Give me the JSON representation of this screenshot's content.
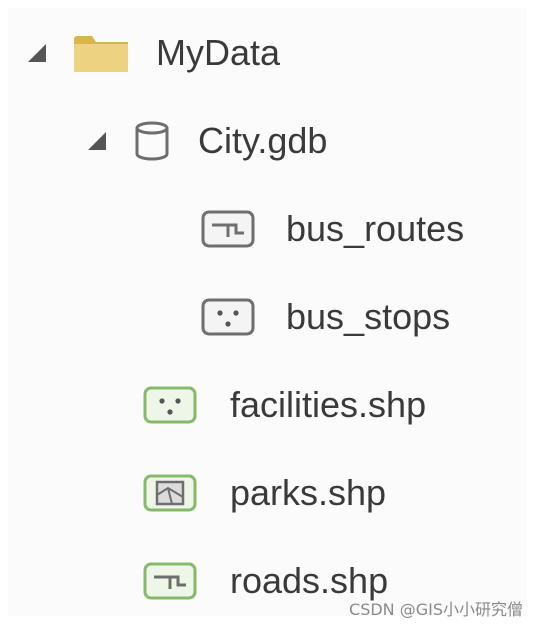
{
  "tree": {
    "root": {
      "label": "MyData",
      "icon": "folder-icon",
      "expanded": true
    },
    "gdb": {
      "label": "City.gdb",
      "icon": "geodatabase-icon",
      "expanded": true
    },
    "gdb_items": [
      {
        "label": "bus_routes",
        "icon": "polyline-featureclass-icon"
      },
      {
        "label": "bus_stops",
        "icon": "point-featureclass-icon"
      }
    ],
    "shapefiles": [
      {
        "label": "facilities.shp",
        "icon": "point-shapefile-icon"
      },
      {
        "label": "parks.shp",
        "icon": "polygon-shapefile-icon"
      },
      {
        "label": "roads.shp",
        "icon": "polyline-shapefile-icon"
      }
    ]
  },
  "watermark": "CSDN @GIS小小研究僧",
  "colors": {
    "folder": "#e8c96a",
    "shapefile_green": "#86b96a",
    "featureclass_gray": "#6e6e6e",
    "text": "#3a3a3a"
  }
}
